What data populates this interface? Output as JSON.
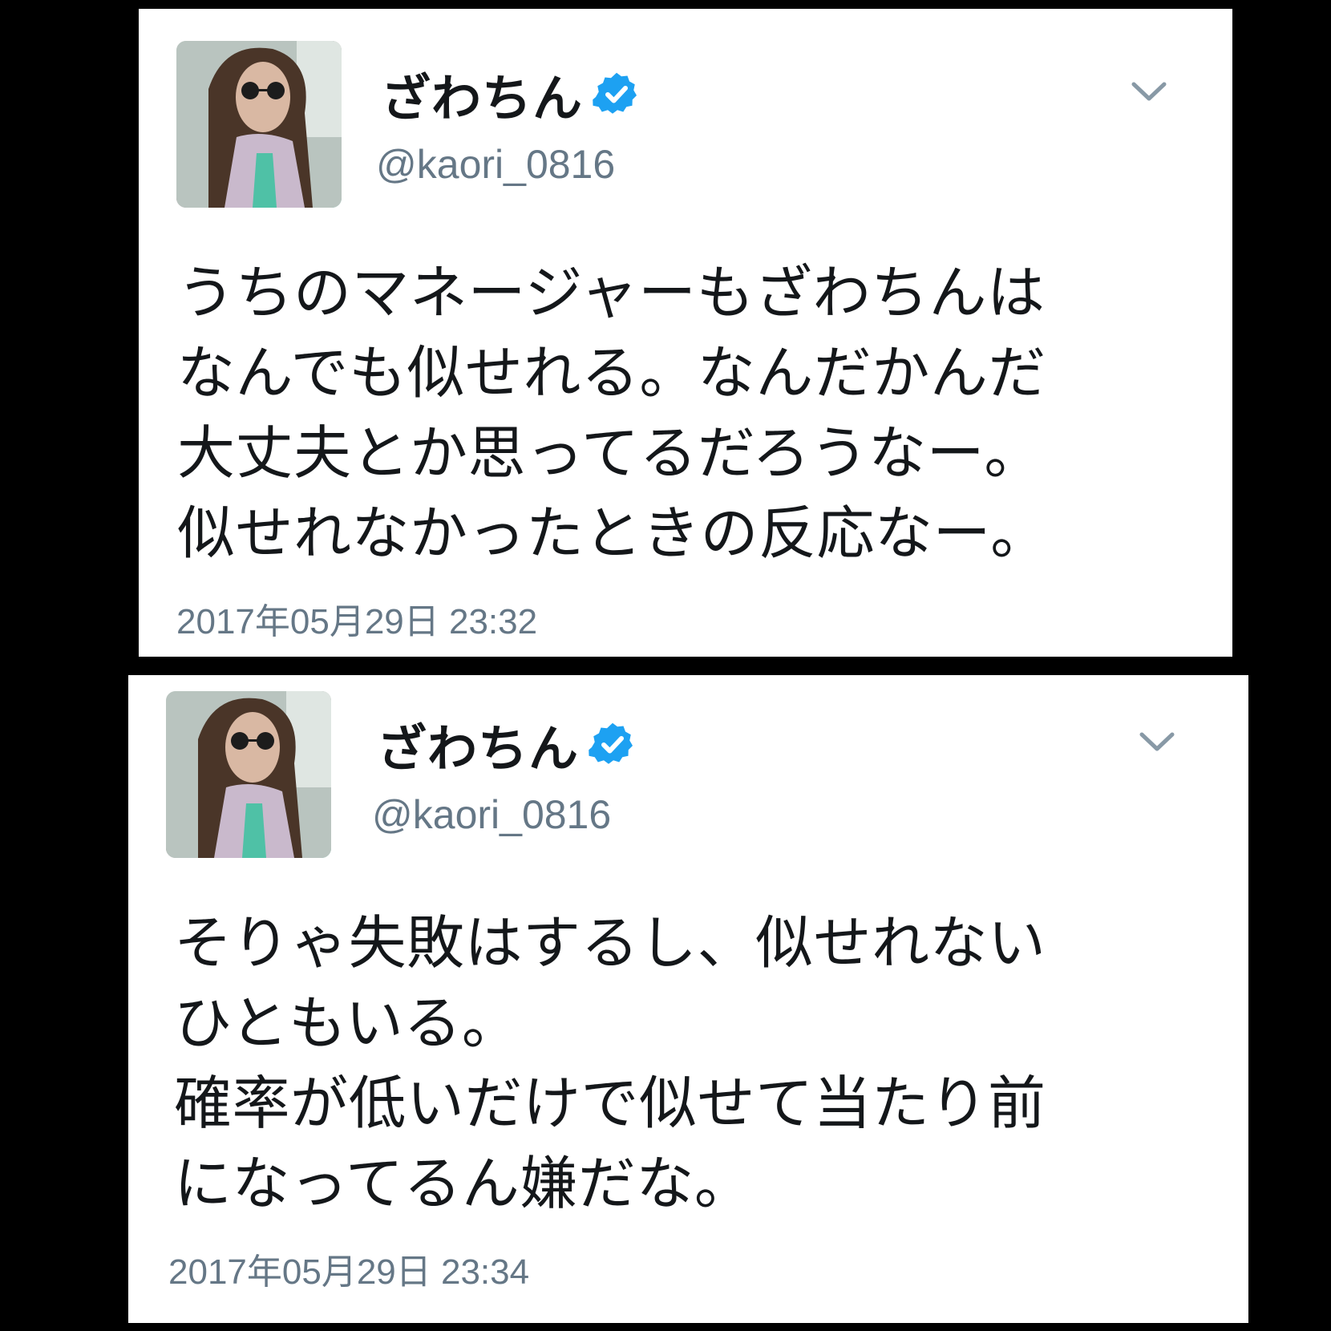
{
  "colors": {
    "background": "#000000",
    "card": "#ffffff",
    "text": "#14171a",
    "secondary_text": "#657786",
    "verified_badge": "#1da1f2"
  },
  "tweets": [
    {
      "avatar_icon": "profile-photo",
      "display_name": "ざわちん",
      "verified_icon": "verified-badge-icon",
      "handle": "@kaori_0816",
      "menu_icon": "chevron-down-icon",
      "text": "うちのマネージャーもざわちんは\nなんでも似せれる。なんだかんだ\n大丈夫とか思ってるだろうなー。\n似せれなかったときの反応なー。",
      "timestamp": "2017年05月29日 23:32"
    },
    {
      "avatar_icon": "profile-photo",
      "display_name": "ざわちん",
      "verified_icon": "verified-badge-icon",
      "handle": "@kaori_0816",
      "menu_icon": "chevron-down-icon",
      "text": "そりゃ失敗はするし、似せれない\nひともいる。\n確率が低いだけで似せて当たり前\nになってるん嫌だな。",
      "timestamp": "2017年05月29日 23:34"
    }
  ]
}
